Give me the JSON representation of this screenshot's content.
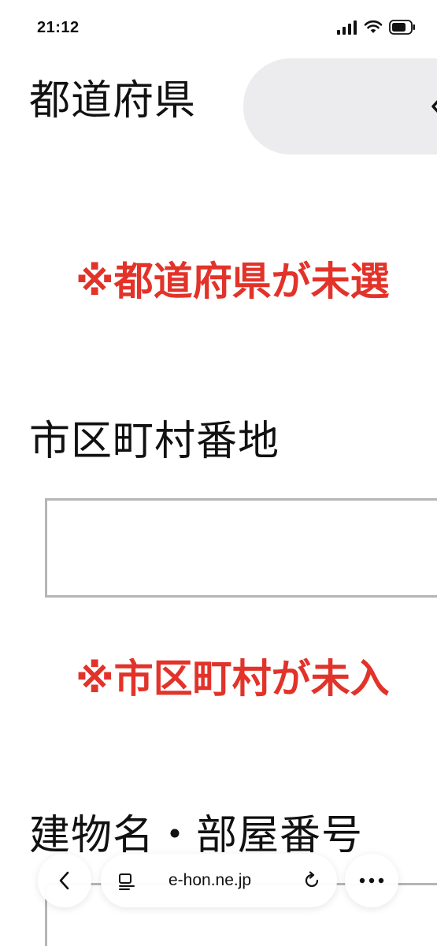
{
  "status_bar": {
    "time": "21:12"
  },
  "form": {
    "prefecture": {
      "label": "都道府県",
      "error": "※都道府県が未選"
    },
    "address": {
      "label": "市区町村番地",
      "value": "",
      "error": "※市区町村が未入"
    },
    "building": {
      "label": "建物名・部屋番号",
      "value": ""
    }
  },
  "browser": {
    "url": "e-hon.ne.jp"
  },
  "colors": {
    "error": "#e2332a",
    "select_bg": "#ececee",
    "input_border": "#b5b5b5"
  }
}
